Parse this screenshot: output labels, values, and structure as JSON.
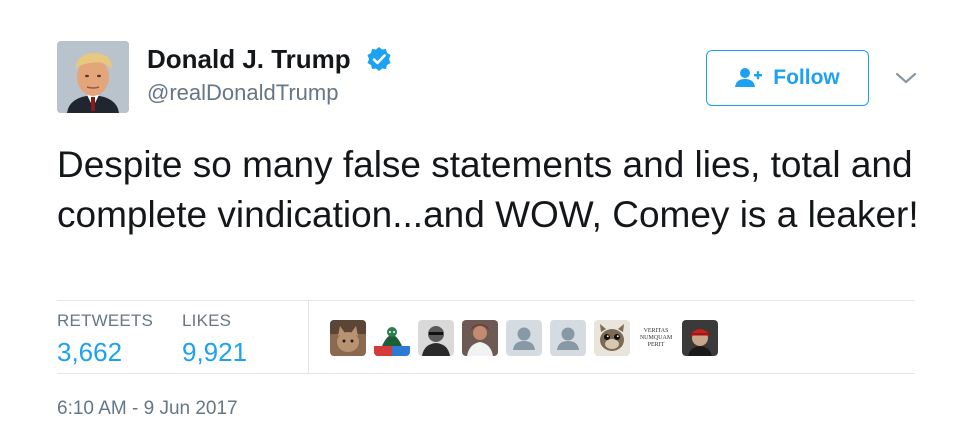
{
  "author": {
    "name": "Donald J. Trump",
    "handle": "@realDonaldTrump",
    "verified": true
  },
  "follow_button": {
    "label": "Follow"
  },
  "tweet": {
    "text": "Despite so many false statements and lies, total and complete vindication...and WOW, Comey is a leaker!"
  },
  "stats": {
    "retweets": {
      "label": "RETWEETS",
      "value": "3,662"
    },
    "likes": {
      "label": "LIKES",
      "value": "9,921"
    }
  },
  "likers": [
    {
      "icon": "cat-photo-avatar"
    },
    {
      "icon": "figure-illustration-avatar"
    },
    {
      "icon": "person-photo-avatar"
    },
    {
      "icon": "person-photo-avatar"
    },
    {
      "icon": "default-avatar"
    },
    {
      "icon": "default-avatar"
    },
    {
      "icon": "animal-photo-avatar"
    },
    {
      "icon": "text-logo-avatar",
      "text": "VERITAS NUMQUAM PERIT"
    },
    {
      "icon": "person-red-hat-avatar"
    }
  ],
  "timestamp": "6:10 AM - 9 Jun 2017",
  "colors": {
    "accent": "#1da1f2",
    "text_primary": "#14171a",
    "text_secondary": "#657786",
    "divider": "#e1e8ed"
  }
}
